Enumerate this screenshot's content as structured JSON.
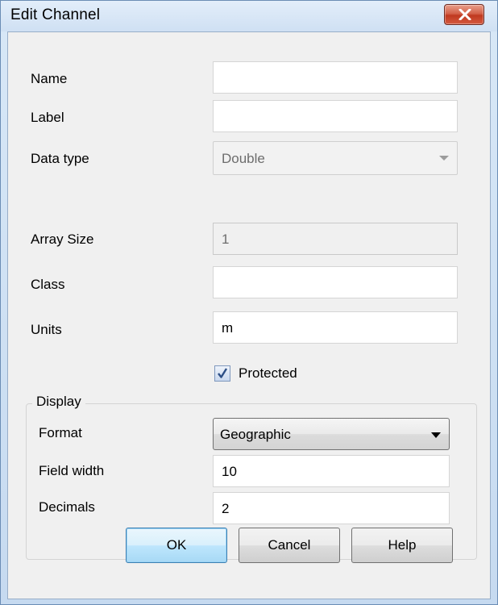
{
  "window": {
    "title": "Edit Channel"
  },
  "form": {
    "name": {
      "label": "Name",
      "value": ""
    },
    "label": {
      "label": "Label",
      "value": ""
    },
    "data_type": {
      "label": "Data type",
      "value": "Double"
    },
    "array_size": {
      "label": "Array Size",
      "value": "1"
    },
    "class": {
      "label": "Class",
      "value": ""
    },
    "units": {
      "label": "Units",
      "value": "m"
    },
    "protected": {
      "label": "Protected",
      "checked": true
    }
  },
  "display": {
    "title": "Display",
    "format": {
      "label": "Format",
      "value": "Geographic"
    },
    "field_width": {
      "label": "Field width",
      "value": "10"
    },
    "decimals": {
      "label": "Decimals",
      "value": "2"
    }
  },
  "buttons": {
    "ok": "OK",
    "cancel": "Cancel",
    "help": "Help"
  },
  "icons": {
    "close": "close-icon",
    "check": "checkmark-icon",
    "dropdown": "chevron-down-icon"
  },
  "colors": {
    "title_bar": "#cfe0f3",
    "close_button": "#c0391f",
    "default_button": "#bee6fd"
  }
}
